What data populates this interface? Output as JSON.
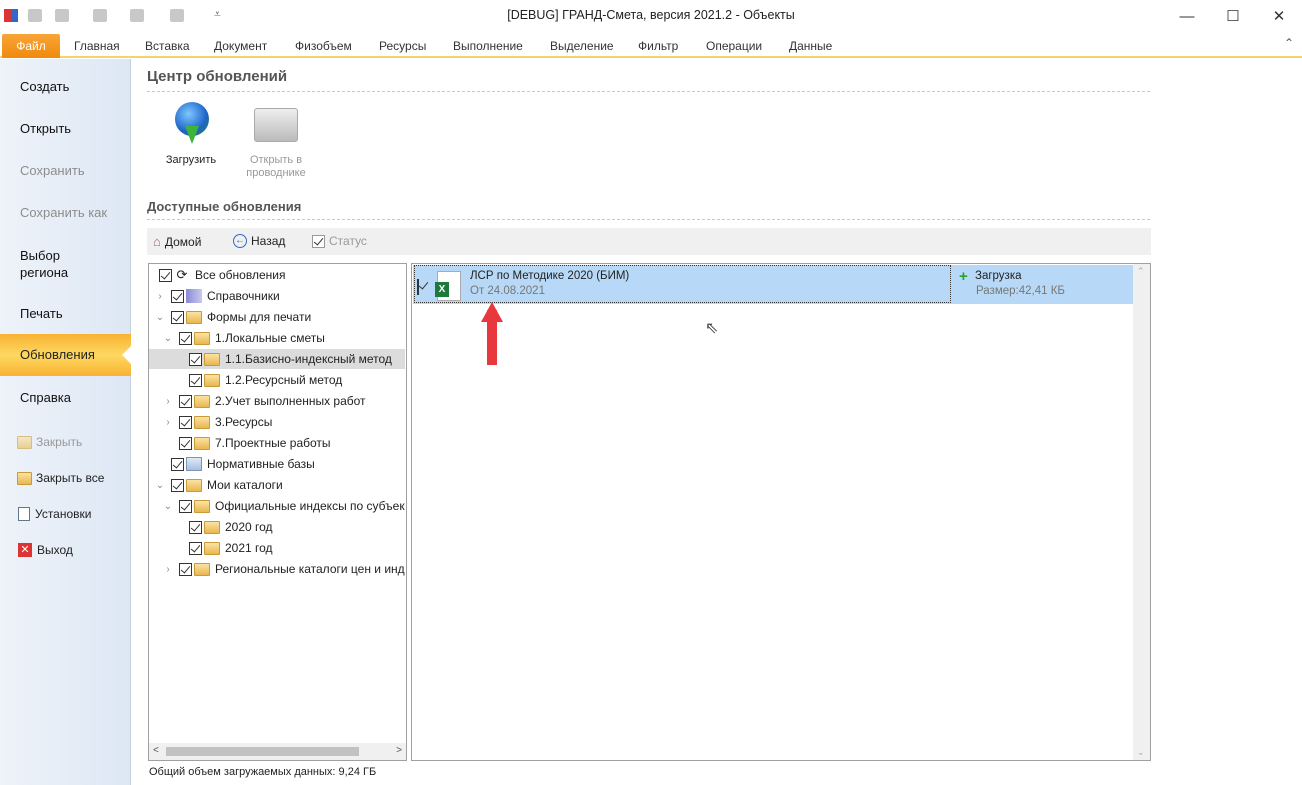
{
  "window": {
    "title": "[DEBUG] ГРАНД-Смета, версия 2021.2 - Объекты",
    "minimize": "—",
    "maximize": "☐",
    "close": "✕"
  },
  "ribbon": {
    "file": "Файл",
    "tabs": [
      "Главная",
      "Вставка",
      "Документ",
      "Физобъем",
      "Ресурсы",
      "Выполнение",
      "Выделение",
      "Фильтр",
      "Операции",
      "Данные"
    ],
    "collapse": "⌃"
  },
  "sidebar": {
    "items": [
      "Создать",
      "Открыть",
      "Сохранить",
      "Сохранить как",
      "Выбор региона",
      "Печать",
      "Обновления",
      "Справка"
    ],
    "sub": [
      "Закрыть",
      "Закрыть все",
      "Установки",
      "Выход"
    ]
  },
  "main": {
    "title": "Центр обновлений",
    "download": "Загрузить",
    "open_explorer": "Открыть в проводнике",
    "available": "Доступные обновления",
    "toolbar": {
      "home": "Домой",
      "back": "Назад",
      "status": "Статус"
    },
    "tree": [
      "Все обновления",
      "Справочники",
      "Формы для печати",
      "1.Локальные сметы",
      "1.1.Базисно-индексный метод",
      "1.2.Ресурсный метод",
      "2.Учет выполненных работ",
      "3.Ресурсы",
      "7.Проектные работы",
      "Нормативные базы",
      "Мои каталоги",
      "Официальные индексы по субъектам",
      "2020 год",
      "2021 год",
      "Региональные каталоги цен и индексов"
    ],
    "update": {
      "name": "ЛСР по Методике 2020 (БИМ)",
      "date": "От 24.08.2021",
      "action": "Загрузка",
      "size": "Размер:42,41 КБ"
    },
    "footer": "Общий объем загружаемых данных: 9,24 ГБ"
  },
  "colors": {
    "accent": "#f59b1f",
    "selection": "#b5d8f7",
    "arrow": "#e8383d"
  }
}
